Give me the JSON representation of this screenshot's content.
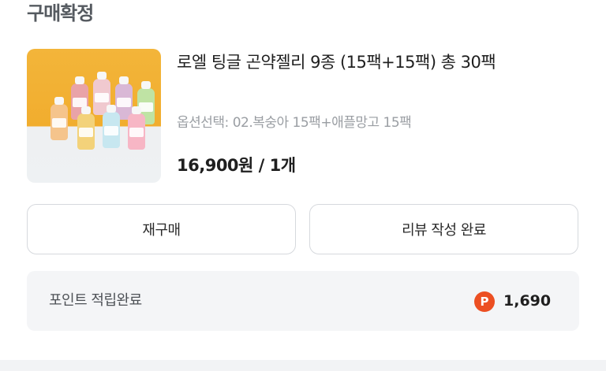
{
  "order": {
    "status": "구매확정",
    "product_title": "로엘 팅글 곤약젤리 9종 (15팩+15팩) 총 30팩",
    "option_text": "옵션선택: 02.복숭아 15팩+애플망고 15팩",
    "price_text": "16,900원 / 1개",
    "thumbnail": {
      "description_icon": "jelly-pouches-image",
      "background": "#f2b134"
    }
  },
  "actions": {
    "rebuy_label": "재구매",
    "review_label": "리뷰 작성 완료"
  },
  "points": {
    "label": "포인트 적립완료",
    "icon_letter": "P",
    "icon_color": "#ec4f22",
    "value": "1,690"
  }
}
